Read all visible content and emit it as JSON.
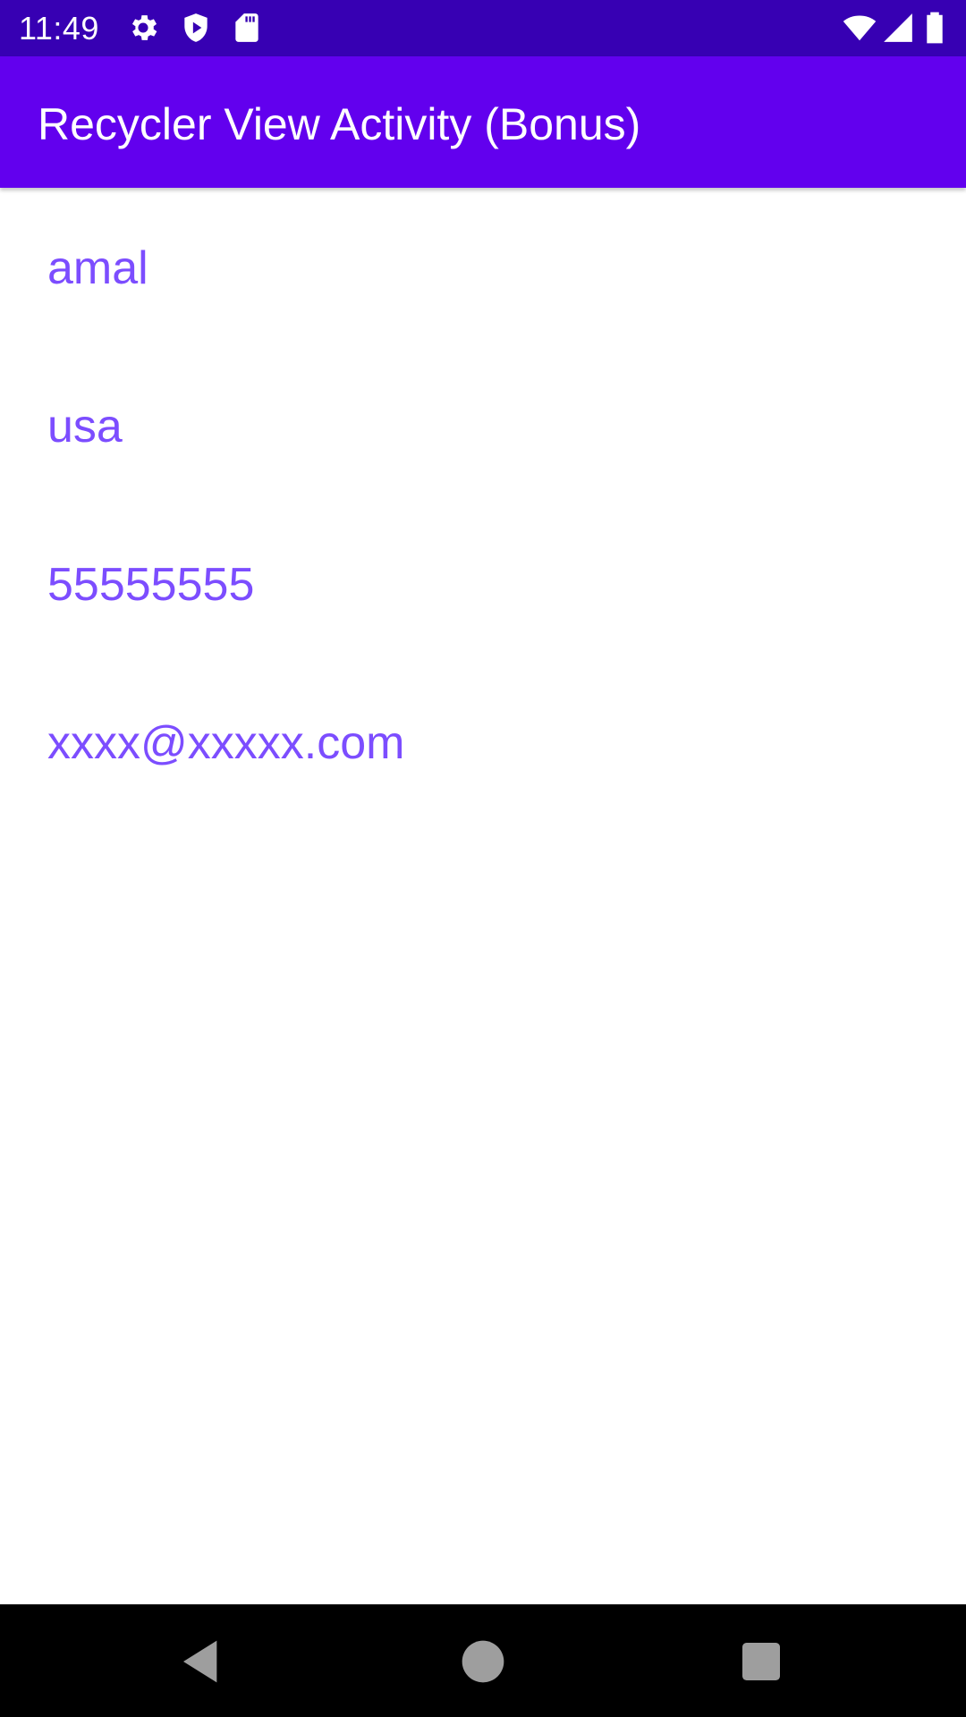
{
  "status_bar": {
    "time": "11:49",
    "icons": [
      "gear-icon",
      "shield-play-icon",
      "sd-card-icon",
      "wifi-icon",
      "cell-signal-icon",
      "battery-icon"
    ],
    "background": "#3700B3"
  },
  "app_bar": {
    "title": "Recycler View Activity (Bonus)",
    "background": "#6200EE"
  },
  "list": {
    "text_color": "#7C4DFF",
    "items": [
      {
        "text": "amal"
      },
      {
        "text": "usa"
      },
      {
        "text": "55555555"
      },
      {
        "text": "xxxx@xxxxx.com"
      }
    ]
  },
  "nav_bar": {
    "buttons": [
      "back-icon",
      "home-icon",
      "recents-icon"
    ]
  }
}
